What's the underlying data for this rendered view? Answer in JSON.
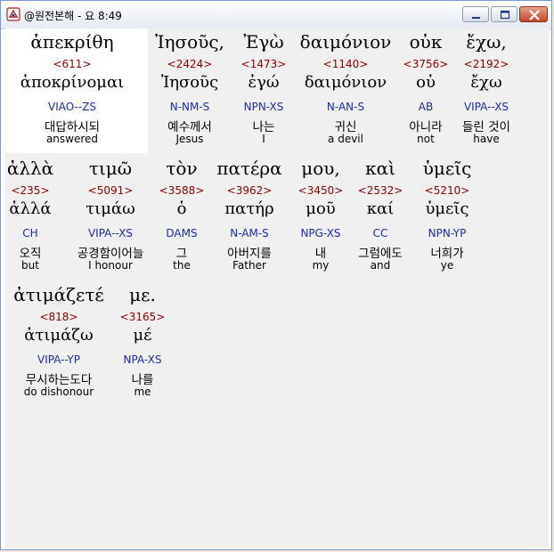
{
  "window": {
    "title": "@원전본해 - 요 8:49"
  },
  "rows": [
    [
      {
        "greek": "ἀπεκρίθη",
        "num": "<611>",
        "lemma": "ἀποκρίνομαι",
        "parse": "VIAO--ZS",
        "kor": "대답하시되",
        "eng": "answered"
      },
      {
        "greek": "Ἰησοῦς,",
        "num": "<2424>",
        "lemma": "Ἰησοῦς",
        "parse": "N-NM-S",
        "kor": "예수께서",
        "eng": "Jesus"
      },
      {
        "greek": "Ἐγὼ",
        "num": "<1473>",
        "lemma": "ἐγώ",
        "parse": "NPN-XS",
        "kor": "나는",
        "eng": "I"
      },
      {
        "greek": "δαιμόνιον",
        "num": "<1140>",
        "lemma": "δαιμόνιον",
        "parse": "N-AN-S",
        "kor": "귀신",
        "eng": "a devil"
      },
      {
        "greek": "οὐκ",
        "num": "<3756>",
        "lemma": "οὐ",
        "parse": "AB",
        "kor": "아니라",
        "eng": "not"
      },
      {
        "greek": "ἔχω,",
        "num": "<2192>",
        "lemma": "ἔχω",
        "parse": "VIPA--XS",
        "kor": "들린 것이",
        "eng": "have"
      }
    ],
    [
      {
        "greek": "ἀλλὰ",
        "num": "<235>",
        "lemma": "ἀλλά",
        "parse": "CH",
        "kor": "오직",
        "eng": "but"
      },
      {
        "greek": "τιμῶ",
        "num": "<5091>",
        "lemma": "τιμάω",
        "parse": "VIPA--XS",
        "kor": "공경함이어늘",
        "eng": "I honour"
      },
      {
        "greek": "τὸν",
        "num": "<3588>",
        "lemma": "ὁ",
        "parse": "DAMS",
        "kor": "그",
        "eng": "the"
      },
      {
        "greek": "πατέρα",
        "num": "<3962>",
        "lemma": "πατήρ",
        "parse": "N-AM-S",
        "kor": "아버지를",
        "eng": "Father"
      },
      {
        "greek": "μου,",
        "num": "<3450>",
        "lemma": "μοῦ",
        "parse": "NPG-XS",
        "kor": "내",
        "eng": "my"
      },
      {
        "greek": "καὶ",
        "num": "<2532>",
        "lemma": "καί",
        "parse": "CC",
        "kor": "그럼에도",
        "eng": "and"
      },
      {
        "greek": "ὑμεῖς",
        "num": "<5210>",
        "lemma": "ὑμεῖς",
        "parse": "NPN-YP",
        "kor": "너희가",
        "eng": "ye"
      }
    ],
    [
      {
        "greek": "ἀτιμάζετέ",
        "num": "<818>",
        "lemma": "ἀτιμάζω",
        "parse": "VIPA--YP",
        "kor": "무시하는도다",
        "eng": "do dishonour"
      },
      {
        "greek": "με.",
        "num": "<3165>",
        "lemma": "μέ",
        "parse": "NPA-XS",
        "kor": "나를",
        "eng": "me"
      }
    ]
  ]
}
